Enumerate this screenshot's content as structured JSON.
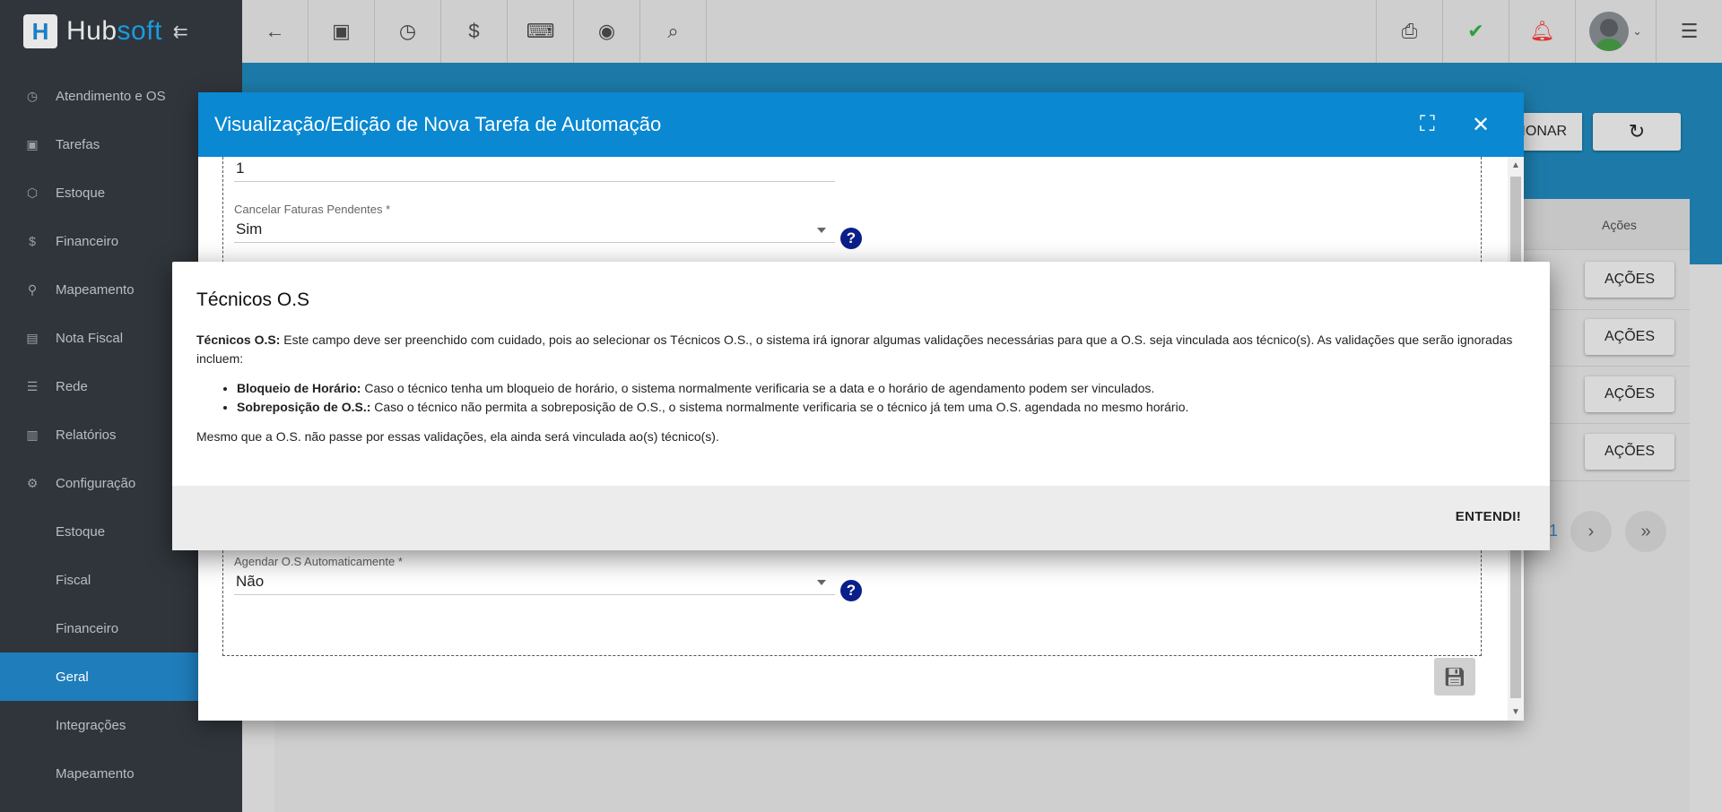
{
  "app": {
    "brand_prefix": "Hub",
    "brand_suffix": "soft"
  },
  "sidebar": {
    "items": [
      {
        "label": "Atendimento e OS",
        "icon": "clock-calendar-icon"
      },
      {
        "label": "Tarefas",
        "icon": "briefcase-icon"
      },
      {
        "label": "Estoque",
        "icon": "box-icon"
      },
      {
        "label": "Financeiro",
        "icon": "dollar-icon"
      },
      {
        "label": "Mapeamento",
        "icon": "map-pin-icon"
      },
      {
        "label": "Nota Fiscal",
        "icon": "document-icon"
      },
      {
        "label": "Rede",
        "icon": "server-icon"
      },
      {
        "label": "Relatórios",
        "icon": "report-icon"
      },
      {
        "label": "Configuração",
        "icon": "gear-icon"
      }
    ],
    "sub_items": [
      {
        "label": "Estoque"
      },
      {
        "label": "Fiscal"
      },
      {
        "label": "Financeiro"
      },
      {
        "label": "Geral",
        "active": true
      },
      {
        "label": "Integrações"
      },
      {
        "label": "Mapeamento"
      }
    ]
  },
  "background": {
    "adicionar_label": "CIONAR",
    "acoes_header": "Ações",
    "acoes_button": "AÇÕES",
    "page_number": "1"
  },
  "modal": {
    "title": "Visualização/Edição de Nova Tarefa de Automação",
    "top_value": "1",
    "cancelar_label": "Cancelar Faturas Pendentes *",
    "cancelar_value": "Sim",
    "agendar_label": "Agendar O.S Automaticamente *",
    "agendar_value": "Não"
  },
  "help_dialog": {
    "title": "Técnicos O.S",
    "intro_bold": "Técnicos O.S:",
    "intro_text": " Este campo deve ser preenchido com cuidado, pois ao selecionar os Técnicos O.S., o sistema irá ignorar algumas validações necessárias para que a O.S. seja vinculada aos técnico(s). As validações que serão ignoradas incluem:",
    "bullets": [
      {
        "bold": "Bloqueio de Horário:",
        "text": " Caso o técnico tenha um bloqueio de horário, o sistema normalmente verificaria se a data e o horário de agendamento podem ser vinculados."
      },
      {
        "bold": "Sobreposição de O.S.:",
        "text": " Caso o técnico não permita a sobreposição de O.S., o sistema normalmente verificaria se o técnico já tem uma O.S. agendada no mesmo horário."
      }
    ],
    "closing": "Mesmo que a O.S. não passe por essas validações, ela ainda será vinculada ao(s) técnico(s).",
    "confirm_label": "ENTENDI!"
  }
}
